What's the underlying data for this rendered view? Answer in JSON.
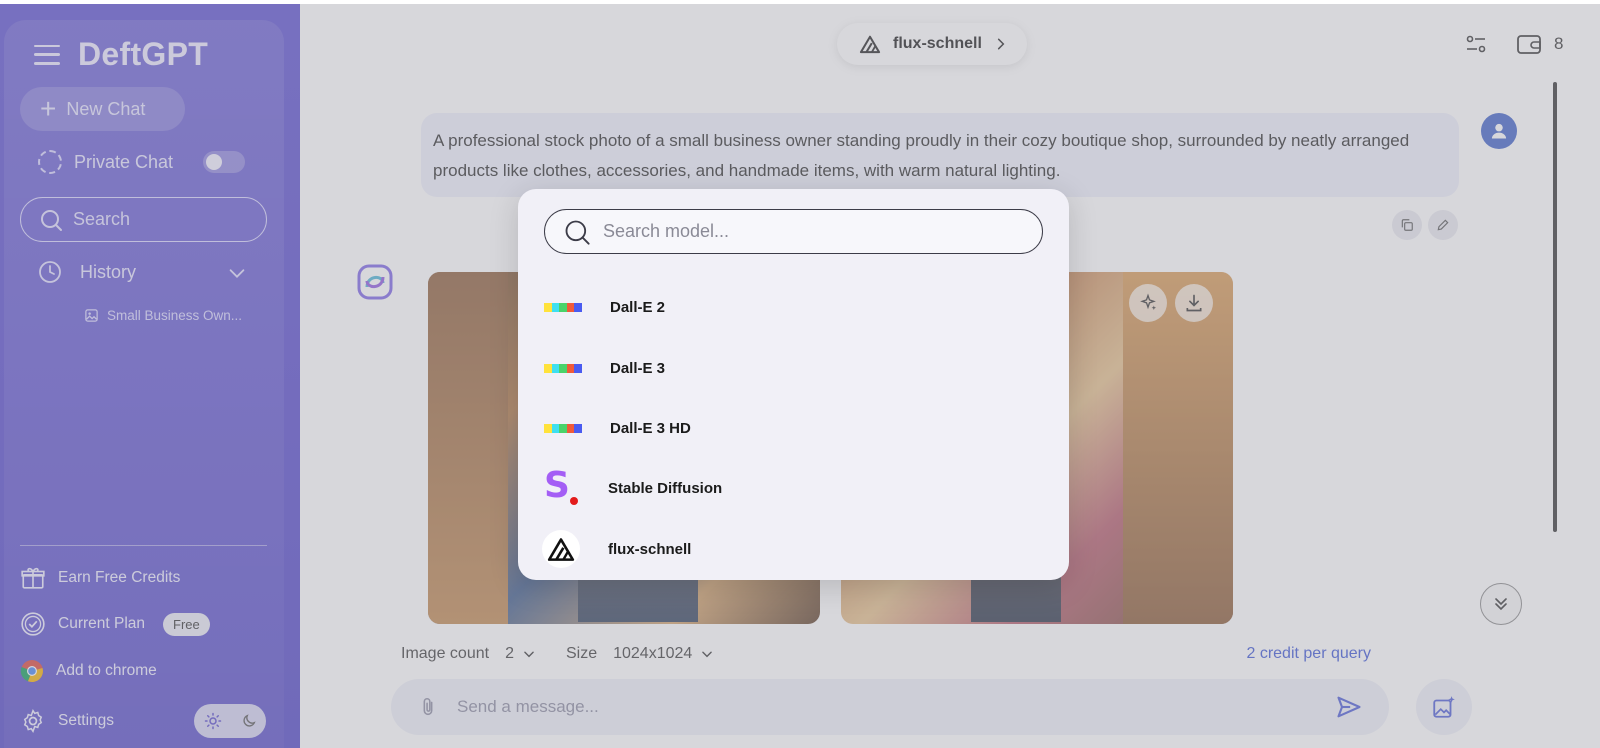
{
  "sidebar": {
    "brand": "DeftGPT",
    "new_chat_label": "New Chat",
    "private_chat_label": "Private Chat",
    "search_placeholder": "Search",
    "history_label": "History",
    "history_items": [
      "Small Business Own..."
    ],
    "earn_credits_label": "Earn Free Credits",
    "current_plan_label": "Current Plan",
    "plan_badge": "Free",
    "add_to_chrome_label": "Add to chrome",
    "settings_label": "Settings"
  },
  "header": {
    "current_model": "flux-schnell",
    "credits": "8"
  },
  "conversation": {
    "user_prompt": "A professional stock photo of a small business owner standing proudly in their cozy boutique shop, surrounded by neatly arranged products like clothes, accessories, and handmade items, with warm natural lighting."
  },
  "options": {
    "image_count_label": "Image count",
    "image_count_value": "2",
    "size_label": "Size",
    "size_value": "1024x1024",
    "credit_note": "2 credit per query"
  },
  "composer": {
    "placeholder": "Send a message..."
  },
  "model_picker": {
    "search_placeholder": "Search model...",
    "models": [
      {
        "label": "Dall-E 2",
        "icon": "openai-rainbow-icon"
      },
      {
        "label": "Dall-E 3",
        "icon": "openai-rainbow-icon"
      },
      {
        "label": "Dall-E 3 HD",
        "icon": "openai-rainbow-icon"
      },
      {
        "label": "Stable Diffusion",
        "icon": "stable-diffusion-icon"
      },
      {
        "label": "flux-schnell",
        "icon": "flux-icon"
      }
    ],
    "rainbow_colors": [
      "#ffe23b",
      "#3ee0f0",
      "#4ad36a",
      "#f05a3a",
      "#4a5bf0"
    ]
  },
  "colors": {
    "sidebar_bg": "#5548cc",
    "accent": "#3b55d6",
    "avatar": "#3e61c9"
  }
}
